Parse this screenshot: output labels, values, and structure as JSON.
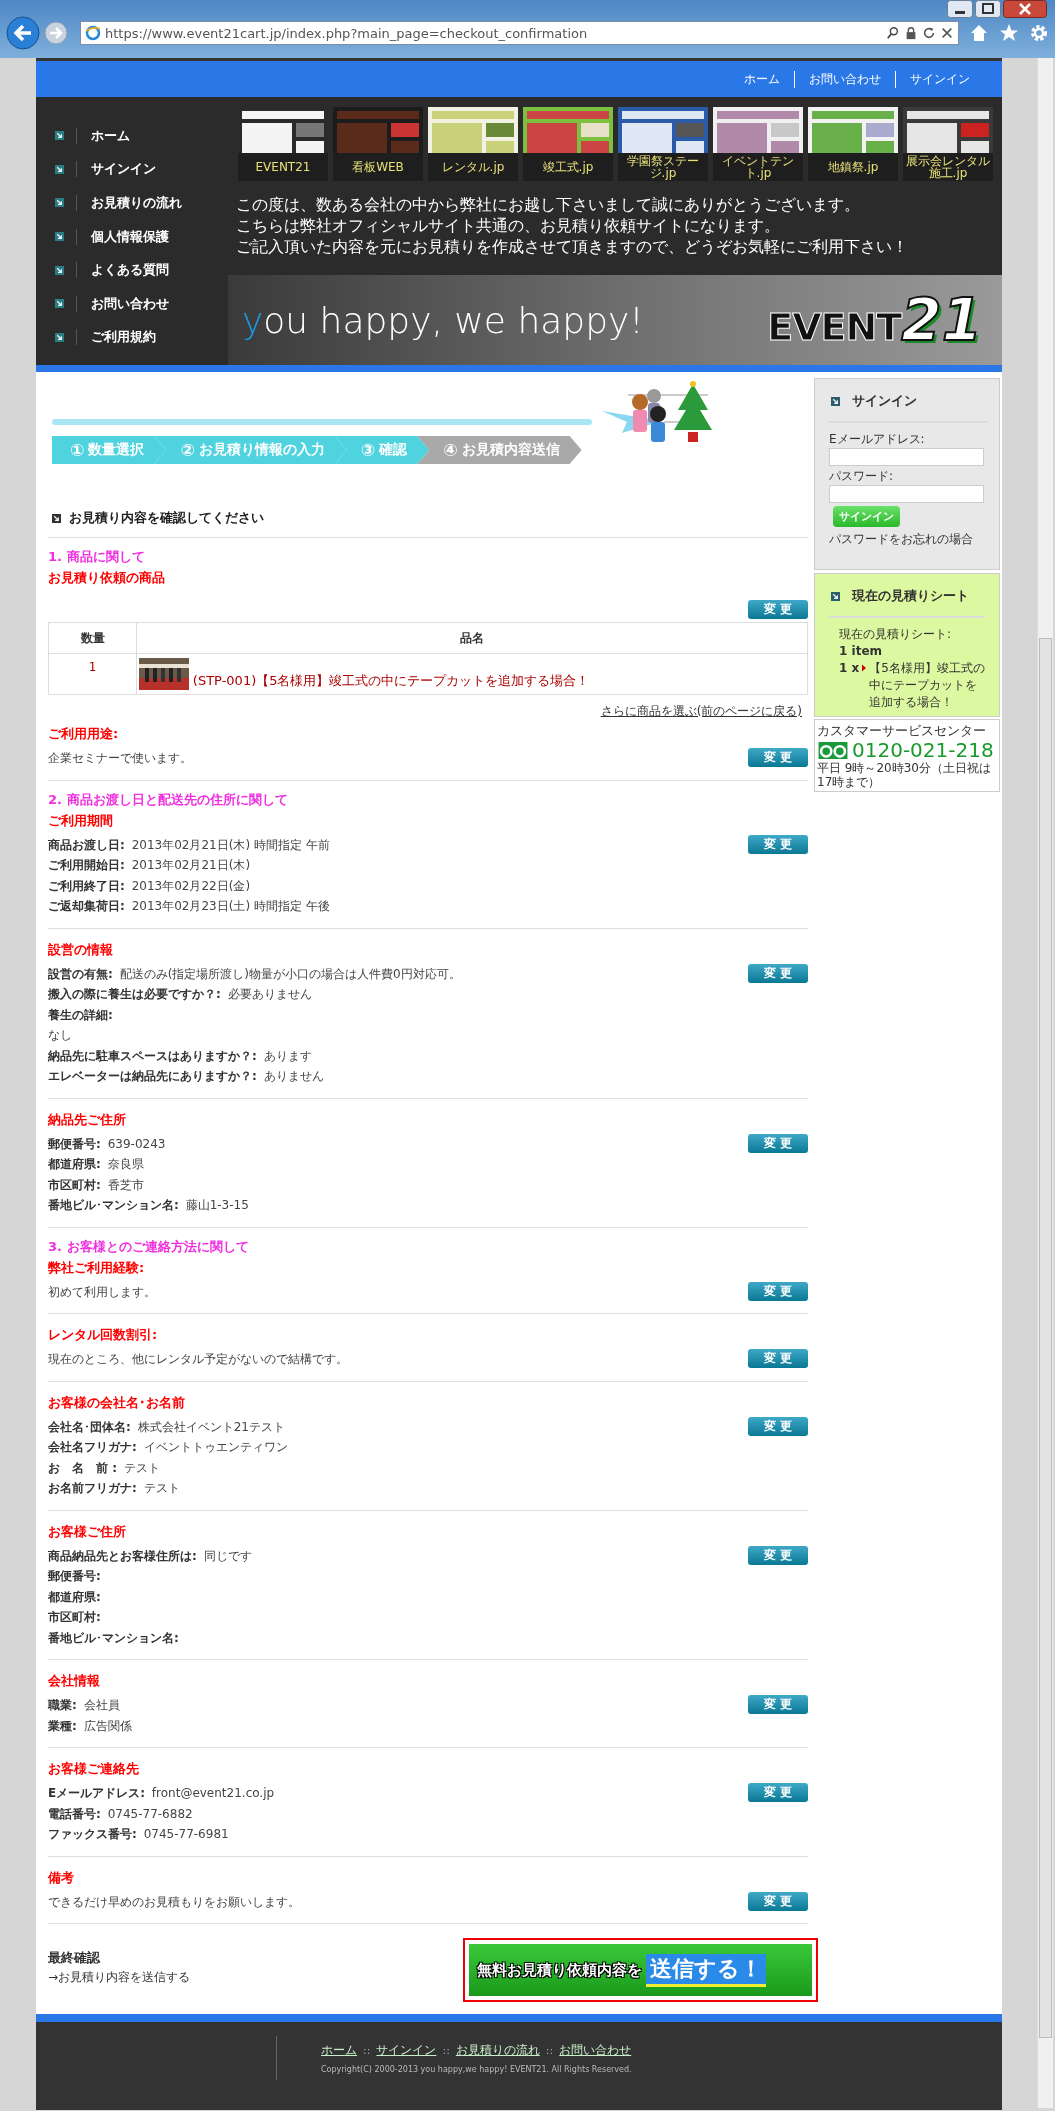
{
  "browser": {
    "url": "https://www.event21cart.jp/index.php?main_page=checkout_confirmation"
  },
  "top_nav": [
    "ホーム",
    "お問い合わせ",
    "サインイン"
  ],
  "side_menu": [
    "ホーム",
    "サインイン",
    "お見積りの流れ",
    "個人情報保護",
    "よくある質問",
    "お問い合わせ",
    "ご利用規約"
  ],
  "banner": {
    "thumbnails": [
      "EVENT21",
      "看板WEB",
      "レンタル.jp",
      "竣工式.jp",
      "学園祭ステージ.jp",
      "イベントテント.jp",
      "地鎮祭.jp",
      "展示会レンタル施工.jp"
    ],
    "greeting": [
      "この度は、数ある会社の中から弊社にお越し下さいまして誠にありがとうございます。",
      "こちらは弊社オフィシャルサイト共通の、お見積り依頼サイトになります。",
      "ご記入頂いた内容を元にお見積りを作成させて頂きますので、どうぞお気軽にご利用下さい！"
    ],
    "slogan": "you happy, we happy!",
    "logo": {
      "word": "EVENT",
      "number": "21"
    }
  },
  "steps": [
    {
      "number": "①",
      "label": "数量選択",
      "reached": true
    },
    {
      "number": "②",
      "label": "お見積り情報の入力",
      "reached": true
    },
    {
      "number": "③",
      "label": "確認",
      "reached": true
    },
    {
      "number": "④",
      "label": "お見積内容送信",
      "reached": false
    }
  ],
  "page_heading": "お見積り内容を確認してください",
  "sections": [
    {
      "group": "1. 商品に関して",
      "blocks": [
        {
          "kind": "products",
          "title": "お見積り依頼の商品",
          "button": "変 更",
          "table": {
            "columns": [
              "数量",
              "品名"
            ],
            "rows": [
              {
                "qty": "1",
                "name": "(STP-001)【5名様用】竣工式の中にテープカットを追加する場合！"
              }
            ]
          },
          "link": "さらに商品を選ぶ(前のページに戻る)"
        },
        {
          "kind": "fields",
          "title": "ご利用用途:",
          "button": "変 更",
          "lines": [
            {
              "value": "企業セミナーで使います。"
            }
          ]
        }
      ]
    },
    {
      "group": "2. 商品お渡し日と配送先の住所に関して",
      "blocks": [
        {
          "kind": "fields",
          "title": "ご利用期間",
          "button": "変 更",
          "lines": [
            {
              "label": "商品お渡し日:",
              "value": "2013年02月21日(木) 時間指定 午前"
            },
            {
              "label": "ご利用開始日:",
              "value": "2013年02月21日(木)"
            },
            {
              "label": "ご利用終了日:",
              "value": "2013年02月22日(金)"
            },
            {
              "label": "ご返却集荷日:",
              "value": "2013年02月23日(土) 時間指定 午後"
            }
          ]
        },
        {
          "kind": "fields",
          "title": "設営の情報",
          "button": "変 更",
          "lines": [
            {
              "label": "設営の有無:",
              "value": "配送のみ(指定場所渡し)物量が小口の場合は人件費0円対応可。"
            },
            {
              "label": "搬入の際に養生は必要ですか？:",
              "value": "必要ありません"
            },
            {
              "label": "養生の詳細:"
            },
            {
              "value": "なし"
            },
            {
              "label": "納品先に駐車スペースはありますか？:",
              "value": "あります"
            },
            {
              "label": "エレベーターは納品先にありますか？:",
              "value": "ありません"
            }
          ]
        },
        {
          "kind": "fields",
          "title": "納品先ご住所",
          "button": "変 更",
          "lines": [
            {
              "label": "郵便番号:",
              "value": "639-0243"
            },
            {
              "label": "都道府県:",
              "value": "奈良県"
            },
            {
              "label": "市区町村:",
              "value": "香芝市"
            },
            {
              "label": "番地ビル･マンション名:",
              "value": "藤山1-3-15"
            }
          ]
        }
      ]
    },
    {
      "group": "3. お客様とのご連絡方法に関して",
      "blocks": [
        {
          "kind": "fields",
          "title": "弊社ご利用経験:",
          "button": "変 更",
          "lines": [
            {
              "value": "初めて利用します。"
            }
          ]
        },
        {
          "kind": "fields",
          "title": "レンタル回数割引:",
          "button": "変 更",
          "lines": [
            {
              "value": "現在のところ、他にレンタル予定がないので結構です。"
            }
          ]
        },
        {
          "kind": "fields",
          "title": "お客様の会社名･お名前",
          "button": "変 更",
          "lines": [
            {
              "label": "会社名･団体名:",
              "value": "株式会社イベント21テスト"
            },
            {
              "label": "会社名フリガナ:",
              "value": "イベントトゥエンティワン"
            },
            {
              "label": "お　名　前 :",
              "value": "テスト"
            },
            {
              "label": "お名前フリガナ:",
              "value": "テスト"
            }
          ]
        },
        {
          "kind": "fields",
          "title": "お客様ご住所",
          "button": "変 更",
          "lines": [
            {
              "label": "商品納品先とお客様住所は:",
              "value": "同じです"
            },
            {
              "label": "郵便番号:"
            },
            {
              "label": "都道府県:"
            },
            {
              "label": "市区町村:"
            },
            {
              "label": "番地ビル･マンション名:"
            }
          ]
        },
        {
          "kind": "fields",
          "title": "会社情報",
          "button": "変 更",
          "lines": [
            {
              "label": "職業:",
              "value": "会社員"
            },
            {
              "label": "業種:",
              "value": "広告関係"
            }
          ]
        },
        {
          "kind": "fields",
          "title": "お客様ご連絡先",
          "button": "変 更",
          "lines": [
            {
              "label": "Eメールアドレス:",
              "value": "front@event21.co.jp"
            },
            {
              "label": "電話番号:",
              "value": "0745-77-6882"
            },
            {
              "label": "ファックス番号:",
              "value": "0745-77-6981"
            }
          ]
        },
        {
          "kind": "fields",
          "title": "備考",
          "button": "変 更",
          "lines": [
            {
              "value": "できるだけ早めのお見積もりをお願いします。"
            }
          ]
        }
      ]
    }
  ],
  "final": {
    "title": "最終確認",
    "text": "→お見積り内容を送信する",
    "submit": {
      "lead": "無料お見積り依頼内容を",
      "action": "送信する！"
    }
  },
  "sidebar": {
    "signin": {
      "title": "サインイン",
      "email_label": "Eメールアドレス:",
      "password_label": "パスワード:",
      "button": "サインイン",
      "forgot": "パスワードをお忘れの場合"
    },
    "cart": {
      "title": "現在の見積りシート",
      "label": "現在の見積りシート:",
      "count": "1 item",
      "qty": "1 x",
      "item": "【5名様用】竣工式の中にテープカットを追加する場合！"
    },
    "contact": {
      "title": "カスタマーサービスセンター",
      "phone": "0120-021-218",
      "hours": "平日 9時～20時30分（土日祝は17時まで）"
    }
  },
  "footer": {
    "links": [
      "ホーム",
      "サインイン",
      "お見積りの流れ",
      "お問い合わせ"
    ],
    "separator": "::",
    "copyright": "Copyright(C) 2000-2013 you happy,we happy! EVENT21. All Rights Reserved."
  }
}
